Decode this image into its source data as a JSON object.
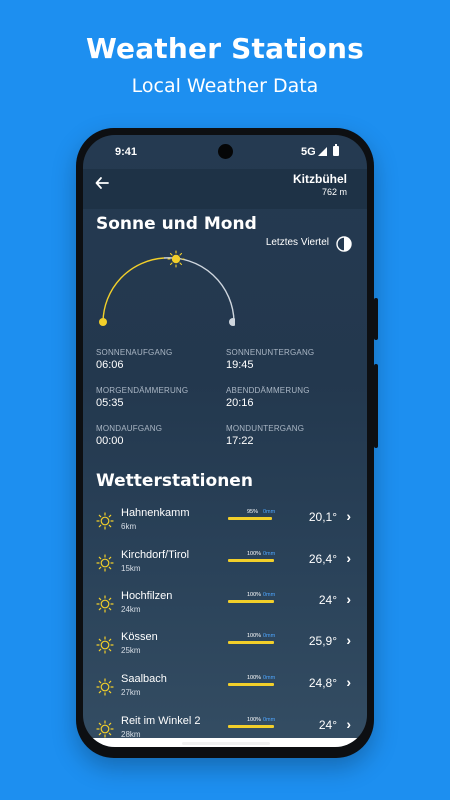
{
  "promo": {
    "title": "Weather Stations",
    "subtitle": "Local Weather Data"
  },
  "statusbar": {
    "time": "9:41",
    "network": "5G"
  },
  "header": {
    "location": "Kitzbühel",
    "altitude": "762 m"
  },
  "sun_moon": {
    "title": "Sonne und Mond",
    "moon_phase": "Letztes Viertel",
    "items": [
      {
        "label": "SONNENAUFGANG",
        "value": "06:06"
      },
      {
        "label": "SONNENUNTERGANG",
        "value": "19:45"
      },
      {
        "label": "MORGENDÄMMERUNG",
        "value": "05:35"
      },
      {
        "label": "ABENDDÄMMERUNG",
        "value": "20:16"
      },
      {
        "label": "MONDAUFGANG",
        "value": "00:00"
      },
      {
        "label": "MONDUNTERGANG",
        "value": "17:22"
      }
    ]
  },
  "stations": {
    "title": "Wetterstationen",
    "items": [
      {
        "name": "Hahnenkamm",
        "distance": "6km",
        "percent": "95%",
        "percent_value": 0.95,
        "precip": "0mm",
        "temp": "20,1°"
      },
      {
        "name": "Kirchdorf/Tirol",
        "distance": "15km",
        "percent": "100%",
        "percent_value": 1.0,
        "precip": "0mm",
        "temp": "26,4°"
      },
      {
        "name": "Hochfilzen",
        "distance": "24km",
        "percent": "100%",
        "percent_value": 1.0,
        "precip": "0mm",
        "temp": "24°"
      },
      {
        "name": "Kössen",
        "distance": "25km",
        "percent": "100%",
        "percent_value": 1.0,
        "precip": "0mm",
        "temp": "25,9°"
      },
      {
        "name": "Saalbach",
        "distance": "27km",
        "percent": "100%",
        "percent_value": 1.0,
        "precip": "0mm",
        "temp": "24,8°"
      },
      {
        "name": "Reit im Winkel 2",
        "distance": "28km",
        "percent": "100%",
        "percent_value": 1.0,
        "precip": "0mm",
        "temp": "24°"
      }
    ]
  },
  "colors": {
    "background": "#1d8ff0",
    "sun": "#f2cf2a",
    "precip": "#4ea6ff"
  },
  "icons": {
    "back": "arrow-left-icon",
    "moon": "half-moon-icon",
    "weather": "sun-icon",
    "chevron": "chevron-right-icon"
  }
}
